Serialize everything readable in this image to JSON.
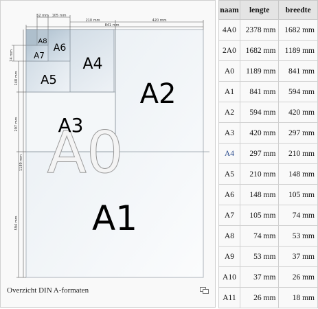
{
  "caption": "Overzicht DIN A-formaten",
  "diagram": {
    "labels": {
      "a0": "A0",
      "a1": "A1",
      "a2": "A2",
      "a3": "A3",
      "a4": "A4",
      "a5": "A5",
      "a6": "A6",
      "a7": "A7",
      "a8": "A8"
    },
    "dims_top": [
      "52 mm",
      "105 mm",
      "210 mm",
      "420 mm",
      "841 mm"
    ],
    "dims_left": [
      "74 mm",
      "148 mm",
      "297 mm",
      "1189 mm",
      "594 mm"
    ]
  },
  "table": {
    "headers": [
      "naam",
      "lengte",
      "breedte"
    ],
    "rows": [
      {
        "name": "4A0",
        "length": "2378 mm",
        "width": "1682 mm"
      },
      {
        "name": "2A0",
        "length": "1682 mm",
        "width": "1189 mm"
      },
      {
        "name": "A0",
        "length": "1189 mm",
        "width": "841 mm"
      },
      {
        "name": "A1",
        "length": "841 mm",
        "width": "594 mm"
      },
      {
        "name": "A2",
        "length": "594 mm",
        "width": "420 mm"
      },
      {
        "name": "A3",
        "length": "420 mm",
        "width": "297 mm"
      },
      {
        "name": "A4",
        "length": "297 mm",
        "width": "210 mm"
      },
      {
        "name": "A5",
        "length": "210 mm",
        "width": "148 mm"
      },
      {
        "name": "A6",
        "length": "148 mm",
        "width": "105 mm"
      },
      {
        "name": "A7",
        "length": "105 mm",
        "width": "74 mm"
      },
      {
        "name": "A8",
        "length": "74 mm",
        "width": "53 mm"
      },
      {
        "name": "A9",
        "length": "53 mm",
        "width": "37 mm"
      },
      {
        "name": "A10",
        "length": "37 mm",
        "width": "26 mm"
      },
      {
        "name": "A11",
        "length": "26 mm",
        "width": "18 mm"
      }
    ]
  }
}
